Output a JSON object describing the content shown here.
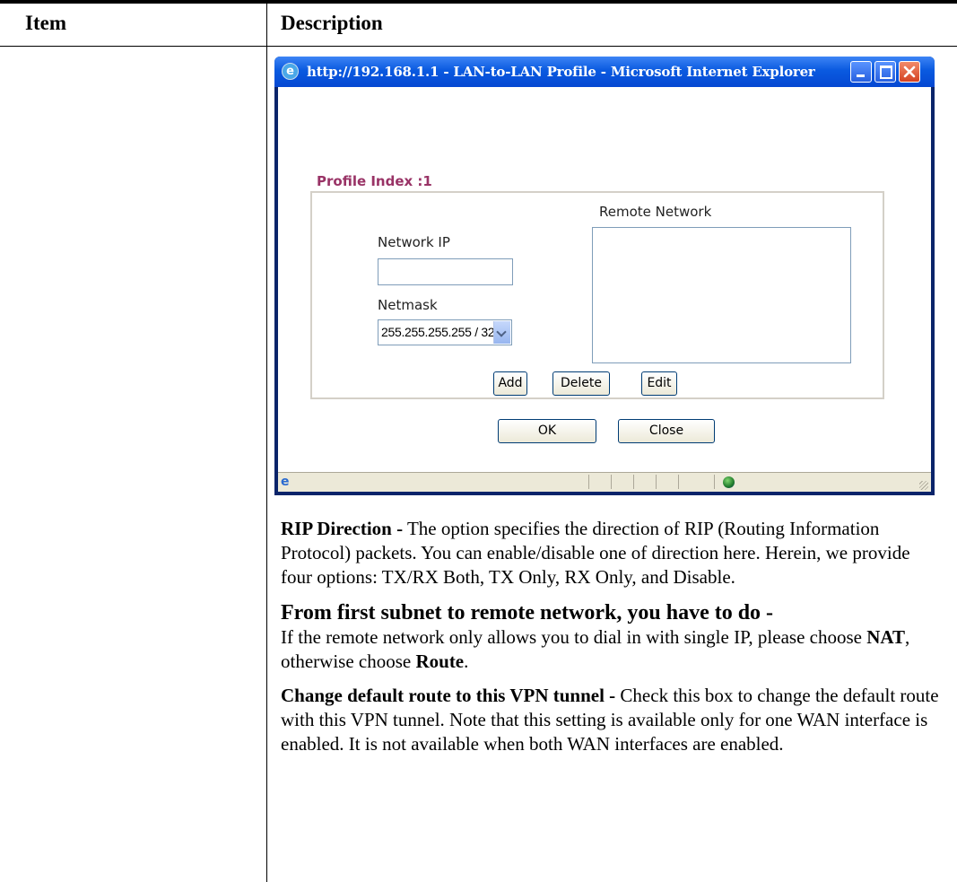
{
  "table": {
    "header_item": "Item",
    "header_description": "Description"
  },
  "popup": {
    "title": "http://192.168.1.1 - LAN-to-LAN Profile - Microsoft Internet Explorer",
    "profile_index": "Profile Index :1",
    "remote_network_label": "Remote Network",
    "network_ip_label": "Network IP",
    "network_ip_value": "",
    "netmask_label": "Netmask",
    "netmask_selected": "255.255.255.255 / 32",
    "add_label": "Add",
    "delete_label": "Delete",
    "edit_label": "Edit",
    "ok_label": "OK",
    "close_label": "Close"
  },
  "description": {
    "rip_title": "RIP Direction -",
    "rip_text": " The option specifies the direction of RIP (Routing Information Protocol) packets. You can enable/disable one of direction here. Herein, we provide four options: TX/RX Both, TX Only, RX Only, and Disable.",
    "subnet_title": "From first subnet to remote network, you have to do -",
    "subnet_text_1": "If the remote network only allows you to dial in with single IP, please choose ",
    "subnet_nat": "NAT",
    "subnet_text_2": ", otherwise choose ",
    "subnet_route": "Route",
    "subnet_text_3": ".",
    "route_title": "Change default route to this VPN tunnel -",
    "route_text": " Check this box to change the default route with this VPN tunnel. Note that this setting is available only for one WAN interface is enabled. It is not available when both WAN interfaces are enabled."
  }
}
